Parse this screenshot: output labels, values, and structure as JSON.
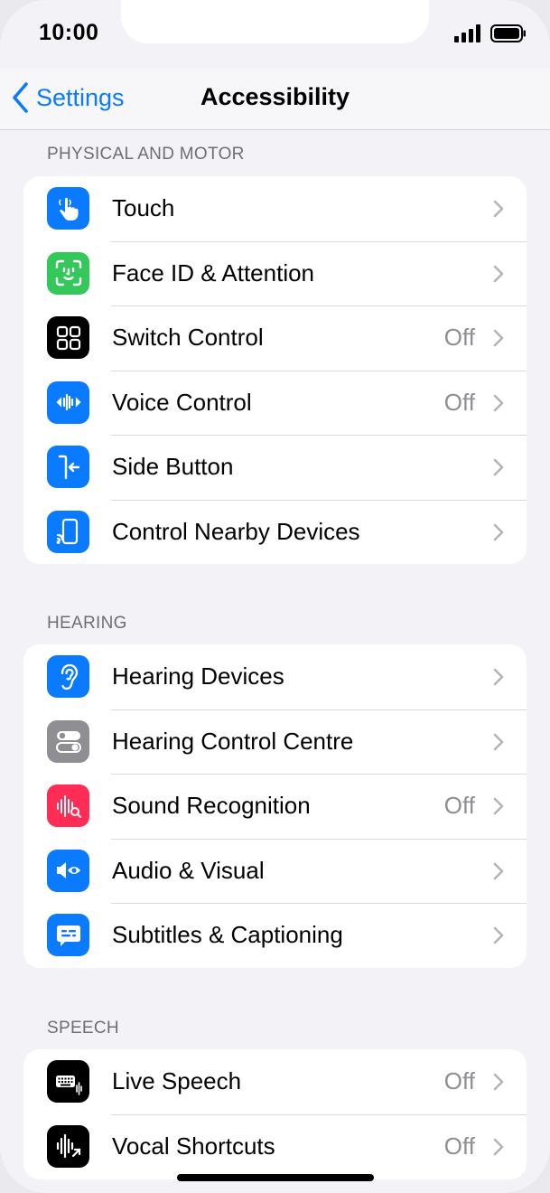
{
  "status_bar": {
    "time": "10:00"
  },
  "nav": {
    "back_label": "Settings",
    "title": "Accessibility"
  },
  "sections": [
    {
      "header": "PHYSICAL AND MOTOR",
      "items": [
        {
          "label": "Touch",
          "value": "",
          "icon": "hand-point-icon",
          "color": "#0a7aff"
        },
        {
          "label": "Face ID & Attention",
          "value": "",
          "icon": "face-id-icon",
          "color": "#34c759"
        },
        {
          "label": "Switch Control",
          "value": "Off",
          "icon": "grid-icon",
          "color": "#000000"
        },
        {
          "label": "Voice Control",
          "value": "Off",
          "icon": "waveform-icon",
          "color": "#0a7aff"
        },
        {
          "label": "Side Button",
          "value": "",
          "icon": "side-button-icon",
          "color": "#0a7aff"
        },
        {
          "label": "Control Nearby Devices",
          "value": "",
          "icon": "phone-cast-icon",
          "color": "#0a7aff"
        }
      ]
    },
    {
      "header": "HEARING",
      "items": [
        {
          "label": "Hearing Devices",
          "value": "",
          "icon": "ear-icon",
          "color": "#0a7aff"
        },
        {
          "label": "Hearing Control Centre",
          "value": "",
          "icon": "toggles-icon",
          "color": "#8e8e93"
        },
        {
          "label": "Sound Recognition",
          "value": "Off",
          "icon": "sound-search-icon",
          "color": "#ff2d55"
        },
        {
          "label": "Audio & Visual",
          "value": "",
          "icon": "speaker-eye-icon",
          "color": "#0a7aff"
        },
        {
          "label": "Subtitles & Captioning",
          "value": "",
          "icon": "caption-bubble-icon",
          "color": "#0a7aff"
        }
      ]
    },
    {
      "header": "SPEECH",
      "items": [
        {
          "label": "Live Speech",
          "value": "Off",
          "icon": "keyboard-wave-icon",
          "color": "#000000"
        },
        {
          "label": "Vocal Shortcuts",
          "value": "Off",
          "icon": "wave-arrow-icon",
          "color": "#000000"
        }
      ]
    }
  ]
}
